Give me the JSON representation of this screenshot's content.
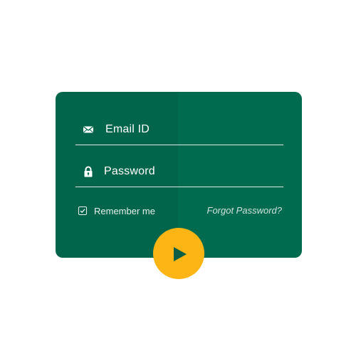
{
  "login_card": {
    "email_label": "Email ID",
    "email_icon": "envelope-icon",
    "password_label": "Password",
    "password_icon": "lock-icon",
    "remember_label": "Remember me",
    "remember_checked": true,
    "forgot_label": "Forgot Password?",
    "submit_icon": "play-icon"
  },
  "colors": {
    "card_background": "#006B4E",
    "accent": "#FDB515",
    "text": "#FFFFFF",
    "page_background": "#FFFFFF"
  }
}
